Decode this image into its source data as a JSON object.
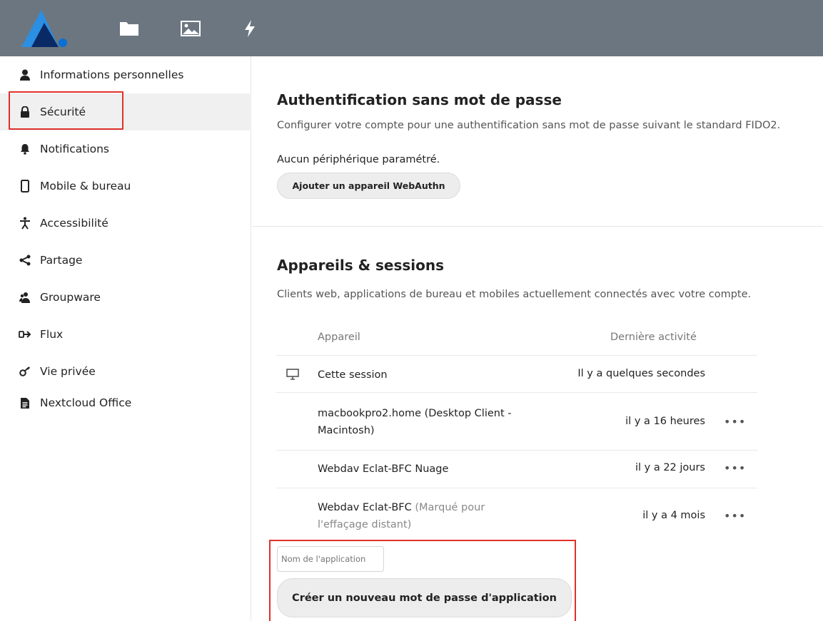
{
  "header": {
    "logo_name": "nextcloud-logo",
    "apps": [
      {
        "name": "files-icon"
      },
      {
        "name": "photos-icon"
      },
      {
        "name": "activity-icon"
      }
    ],
    "color": "#6b7680"
  },
  "sidebar": {
    "items": [
      {
        "label": "Informations personnelles",
        "icon": "user-icon"
      },
      {
        "label": "Sécurité",
        "icon": "lock-icon",
        "active": true
      },
      {
        "label": "Notifications",
        "icon": "bell-icon"
      },
      {
        "label": "Mobile & bureau",
        "icon": "phone-icon"
      },
      {
        "label": "Accessibilité",
        "icon": "accessibility-icon"
      },
      {
        "label": "Partage",
        "icon": "share-icon"
      },
      {
        "label": "Groupware",
        "icon": "groupware-icon"
      },
      {
        "label": "Flux",
        "icon": "flux-icon"
      },
      {
        "label": "Vie privée",
        "icon": "privacy-icon"
      },
      {
        "label": "Nextcloud Office",
        "icon": "document-icon"
      }
    ]
  },
  "passwordless": {
    "title": "Authentification sans mot de passe",
    "description": "Configurer votre compte pour une authentification sans mot de passe suivant le standard FIDO2.",
    "status": "Aucun périphérique paramétré.",
    "add_button": "Ajouter un appareil WebAuthn"
  },
  "sessions": {
    "title": "Appareils & sessions",
    "description": "Clients web, applications de bureau et mobiles actuellement connectés avec votre compte.",
    "col_device": "Appareil",
    "col_activity": "Dernière activité",
    "rows": [
      {
        "name": "Cette session",
        "time": "Il y a quelques secondes"
      },
      {
        "name": "macbookpro2.home (Desktop Client - Macintosh)",
        "time": "il y a 16 heures",
        "more": "•••"
      },
      {
        "name": "Webdav Eclat-BFC Nuage",
        "time": "il y a 22 jours",
        "more": "•••"
      },
      {
        "name": "Webdav Eclat-BFC",
        "note": "(Marqué pour l'effaçage distant)",
        "time": "il y a 4 mois",
        "more": "•••"
      }
    ],
    "app_name_placeholder": "Nom de l'application",
    "create_button": "Créer un nouveau mot de passe d'application"
  },
  "colors": {
    "accent_highlight": "#e0312a",
    "active_bg": "#f0f0f0"
  }
}
